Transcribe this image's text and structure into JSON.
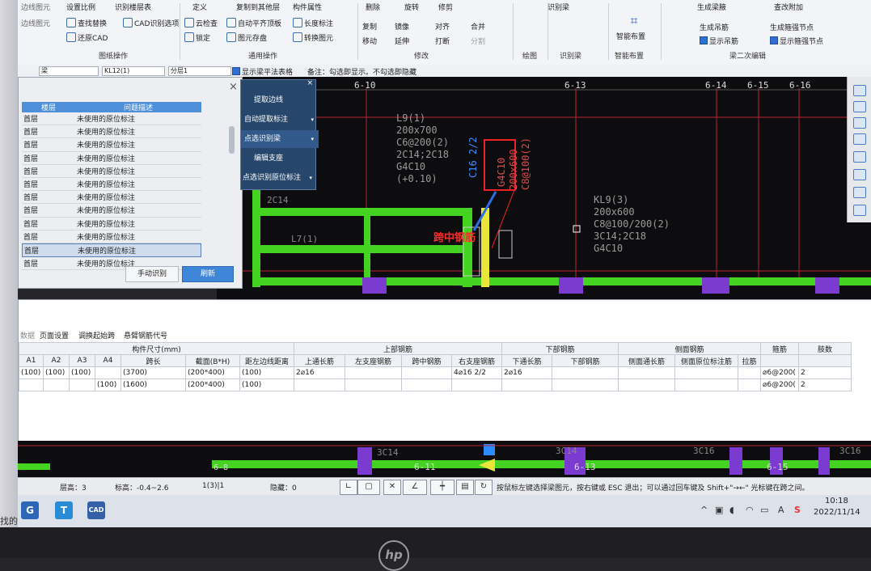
{
  "ribbon": {
    "row1": [
      "设置比例",
      "识别楼层表",
      "定义",
      "复制到其他层",
      "构件属性",
      "删除",
      "旋转",
      "修剪",
      "识别梁",
      "生成梁腋",
      "查改附加"
    ],
    "left_items": [
      "边线图元",
      "查找替换",
      "CAD识别选项",
      "还原CAD"
    ],
    "mid_items": [
      "云检查",
      "锁定",
      "自动平齐顶板",
      "图元存盘",
      "长度标注",
      "转换图元"
    ],
    "modify_items": [
      "复制",
      "镜像",
      "对齐",
      "合并",
      "移动",
      "延伸",
      "打断",
      "分割"
    ],
    "smart_label": "智能布置",
    "right_items": [
      "生成吊筋",
      "生成吊筋",
      "显示吊筋",
      "生成箍强节点",
      "显示箍强节点"
    ],
    "groups": [
      "图纸操作",
      "通用操作",
      "修改",
      "绘图",
      "识别梁",
      "智能布置",
      "梁二次编辑"
    ]
  },
  "selector": {
    "type": "梁",
    "member": "KL12(1)",
    "layer": "分层1",
    "checkbox_label": "显示梁平法表格",
    "note": "备注：勾选即显示。不勾选即隐藏"
  },
  "problems": {
    "header_floor": "楼层",
    "header_desc": "问题描述",
    "rows": [
      {
        "floor": "首层",
        "desc": "未使用的原位标注"
      },
      {
        "floor": "首层",
        "desc": "未使用的原位标注"
      },
      {
        "floor": "首层",
        "desc": "未使用的原位标注"
      },
      {
        "floor": "首层",
        "desc": "未使用的原位标注"
      },
      {
        "floor": "首层",
        "desc": "未使用的原位标注"
      },
      {
        "floor": "首层",
        "desc": "未使用的原位标注"
      },
      {
        "floor": "首层",
        "desc": "未使用的原位标注"
      },
      {
        "floor": "首层",
        "desc": "未使用的原位标注"
      },
      {
        "floor": "首层",
        "desc": "未使用的原位标注"
      },
      {
        "floor": "首层",
        "desc": "未使用的原位标注"
      },
      {
        "floor": "首层",
        "desc": "未使用的原位标注"
      },
      {
        "floor": "首层",
        "desc": "未使用的原位标注"
      }
    ],
    "selected_index": 10,
    "manual_btn": "手动识别",
    "refresh_btn": "刷新",
    "close": "×"
  },
  "menu": {
    "items": [
      {
        "label": "提取边线",
        "arrow": ""
      },
      {
        "label": "自动提取标注",
        "arrow": "▾"
      },
      {
        "label": "点选识别梁",
        "arrow": "▾"
      },
      {
        "label": "编辑支座",
        "arrow": ""
      },
      {
        "label": "点选识别原位标注",
        "arrow": "▾"
      }
    ],
    "close": "×"
  },
  "cad": {
    "axes": [
      "6-10",
      "6-13",
      "6-14",
      "6-15",
      "6-16"
    ],
    "beam_left": [
      "L9(1)",
      "200x700",
      "C6@200(2)",
      "2C14;2C18",
      "G4C10",
      "(+0.10)"
    ],
    "highlight_text": "C16 2/2",
    "red_vertical": [
      "G4C10",
      "200x600",
      "C8@100(2)"
    ],
    "kl9": [
      "KL9(3)",
      "200x600",
      "C8@100/200(2)",
      "3C14;2C18",
      "G4C10"
    ],
    "callout": "跨中钢筋",
    "misc": [
      "2C14",
      "L7(1)",
      "2C8@10C14"
    ],
    "bottom_labels": [
      "3C14",
      "3C14",
      "3C16",
      "3C16",
      "6-8",
      "6-11",
      "6-13",
      "6-15"
    ]
  },
  "rebar": {
    "tabs": [
      "数据",
      "页面设置",
      "调换起始跨",
      "悬臂钢筋代号"
    ],
    "group_size": "构件尺寸(mm)",
    "group_top": "上部钢筋",
    "group_bottom": "下部钢筋",
    "group_side": "侧面钢筋",
    "headers": [
      "A1",
      "A2",
      "A3",
      "A4",
      "跨长",
      "截面(B*H)",
      "距左边线距离",
      "上通长筋",
      "左支座钢筋",
      "跨中钢筋",
      "右支座钢筋",
      "下通长筋",
      "下部钢筋",
      "侧面通长筋",
      "侧面原位标注筋",
      "拉筋",
      "箍筋",
      "肢数"
    ],
    "rows": [
      [
        "(100)",
        "(100)",
        "(100)",
        "",
        "(3700)",
        "(200*400)",
        "(100)",
        "2⌀16",
        "",
        "",
        "4⌀16 2/2",
        "2⌀16",
        "",
        "",
        "",
        "",
        "⌀6@200(",
        "2"
      ],
      [
        "",
        "",
        "",
        "(100)",
        "(1600)",
        "(200*400)",
        "(100)",
        "",
        "",
        "",
        "",
        "",
        "",
        "",
        "",
        "",
        "⌀6@200(",
        "2"
      ]
    ]
  },
  "status": {
    "floor_height": "层高：3",
    "elevation": "标高：-0.4~2.6",
    "count": "1(3)|1",
    "hidden": "隐藏：0",
    "hint": "按鼠标左键选择梁图元，按右键或 ESC 退出；可以通过回车键及 Shift+\"→←\" 光标键在跨之间。"
  },
  "taskbar": {
    "time": "10:18",
    "date": "2022/11/14",
    "apps": [
      "G",
      "T",
      "CAD"
    ],
    "tray_ime": "A",
    "tray_s": "S"
  },
  "edge_text": "找的"
}
